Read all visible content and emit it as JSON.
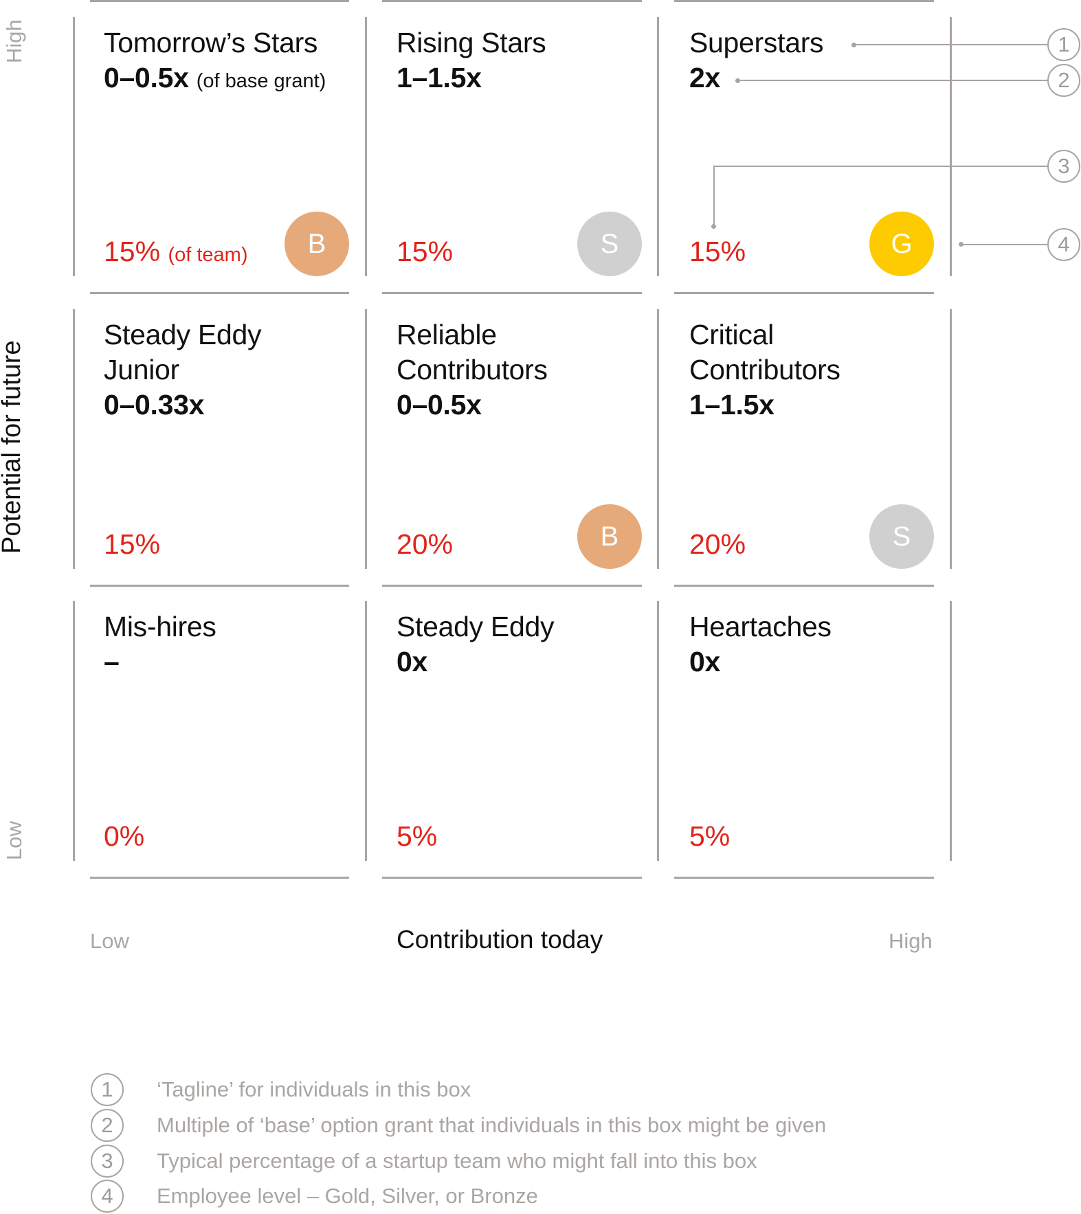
{
  "axes": {
    "y_title": "Potential for future",
    "y_high": "High",
    "y_low": "Low",
    "x_title": "Contribution today",
    "x_low": "Low",
    "x_high": "High"
  },
  "colors": {
    "percent_text": "#e2231a",
    "gold": "#fdcb00",
    "silver": "#d0d0d0",
    "bronze": "#e5a97a",
    "lines": "#aaa4a1"
  },
  "cells": [
    {
      "row": "high",
      "col": "low",
      "tagline_lines": [
        "Tomorrow’s Stars"
      ],
      "multiple": "0–0.5x",
      "multiple_note": "(of base grant)",
      "percent": "15%",
      "percent_note": "(of team)",
      "level": "B",
      "level_name": "bronze"
    },
    {
      "row": "high",
      "col": "mid",
      "tagline_lines": [
        "Rising Stars"
      ],
      "multiple": "1–1.5x",
      "multiple_note": "",
      "percent": "15%",
      "percent_note": "",
      "level": "S",
      "level_name": "silver"
    },
    {
      "row": "high",
      "col": "high",
      "tagline_lines": [
        "Superstars"
      ],
      "multiple": "2x",
      "multiple_note": "",
      "percent": "15%",
      "percent_note": "",
      "level": "G",
      "level_name": "gold"
    },
    {
      "row": "mid",
      "col": "low",
      "tagline_lines": [
        "Steady Eddy",
        "Junior"
      ],
      "multiple": "0–0.33x",
      "multiple_note": "",
      "percent": "15%",
      "percent_note": "",
      "level": "",
      "level_name": ""
    },
    {
      "row": "mid",
      "col": "mid",
      "tagline_lines": [
        "Reliable",
        "Contributors"
      ],
      "multiple": "0–0.5x",
      "multiple_note": "",
      "percent": "20%",
      "percent_note": "",
      "level": "B",
      "level_name": "bronze"
    },
    {
      "row": "mid",
      "col": "high",
      "tagline_lines": [
        "Critical",
        "Contributors"
      ],
      "multiple": "1–1.5x",
      "multiple_note": "",
      "percent": "20%",
      "percent_note": "",
      "level": "S",
      "level_name": "silver"
    },
    {
      "row": "low",
      "col": "low",
      "tagline_lines": [
        "Mis-hires"
      ],
      "multiple": "–",
      "multiple_note": "",
      "percent": "0%",
      "percent_note": "",
      "level": "",
      "level_name": ""
    },
    {
      "row": "low",
      "col": "mid",
      "tagline_lines": [
        "Steady Eddy"
      ],
      "multiple": "0x",
      "multiple_note": "",
      "percent": "5%",
      "percent_note": "",
      "level": "",
      "level_name": ""
    },
    {
      "row": "low",
      "col": "high",
      "tagline_lines": [
        "Heartaches"
      ],
      "multiple": "0x",
      "multiple_note": "",
      "percent": "5%",
      "percent_note": "",
      "level": "",
      "level_name": ""
    }
  ],
  "callouts": [
    "1",
    "2",
    "3",
    "4"
  ],
  "legend": [
    {
      "num": "1",
      "text": "‘Tagline’ for individuals in this box"
    },
    {
      "num": "2",
      "text": "Multiple of ‘base’ option grant that individuals in this box might be given"
    },
    {
      "num": "3",
      "text": "Typical percentage of a startup team who might fall into this box"
    },
    {
      "num": "4",
      "text": "Employee level – Gold, Silver, or Bronze"
    }
  ]
}
